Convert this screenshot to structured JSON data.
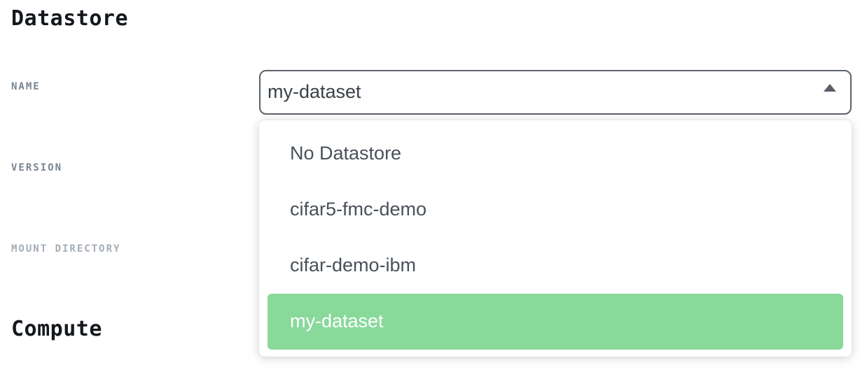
{
  "sections": {
    "datastore_title": "Datastore",
    "compute_title": "Compute"
  },
  "fields": {
    "name_label": "NAME",
    "version_label": "VERSION",
    "mount_label": "MOUNT DIRECTORY"
  },
  "name_select": {
    "value": "my-dataset",
    "expanded": true,
    "caret_icon": "caret-up-icon",
    "options": [
      "No Datastore",
      "cifar5-fmc-demo",
      "cifar-demo-ibm",
      "my-dataset"
    ],
    "selected_index": 3,
    "selected_color": "#89d99a"
  }
}
